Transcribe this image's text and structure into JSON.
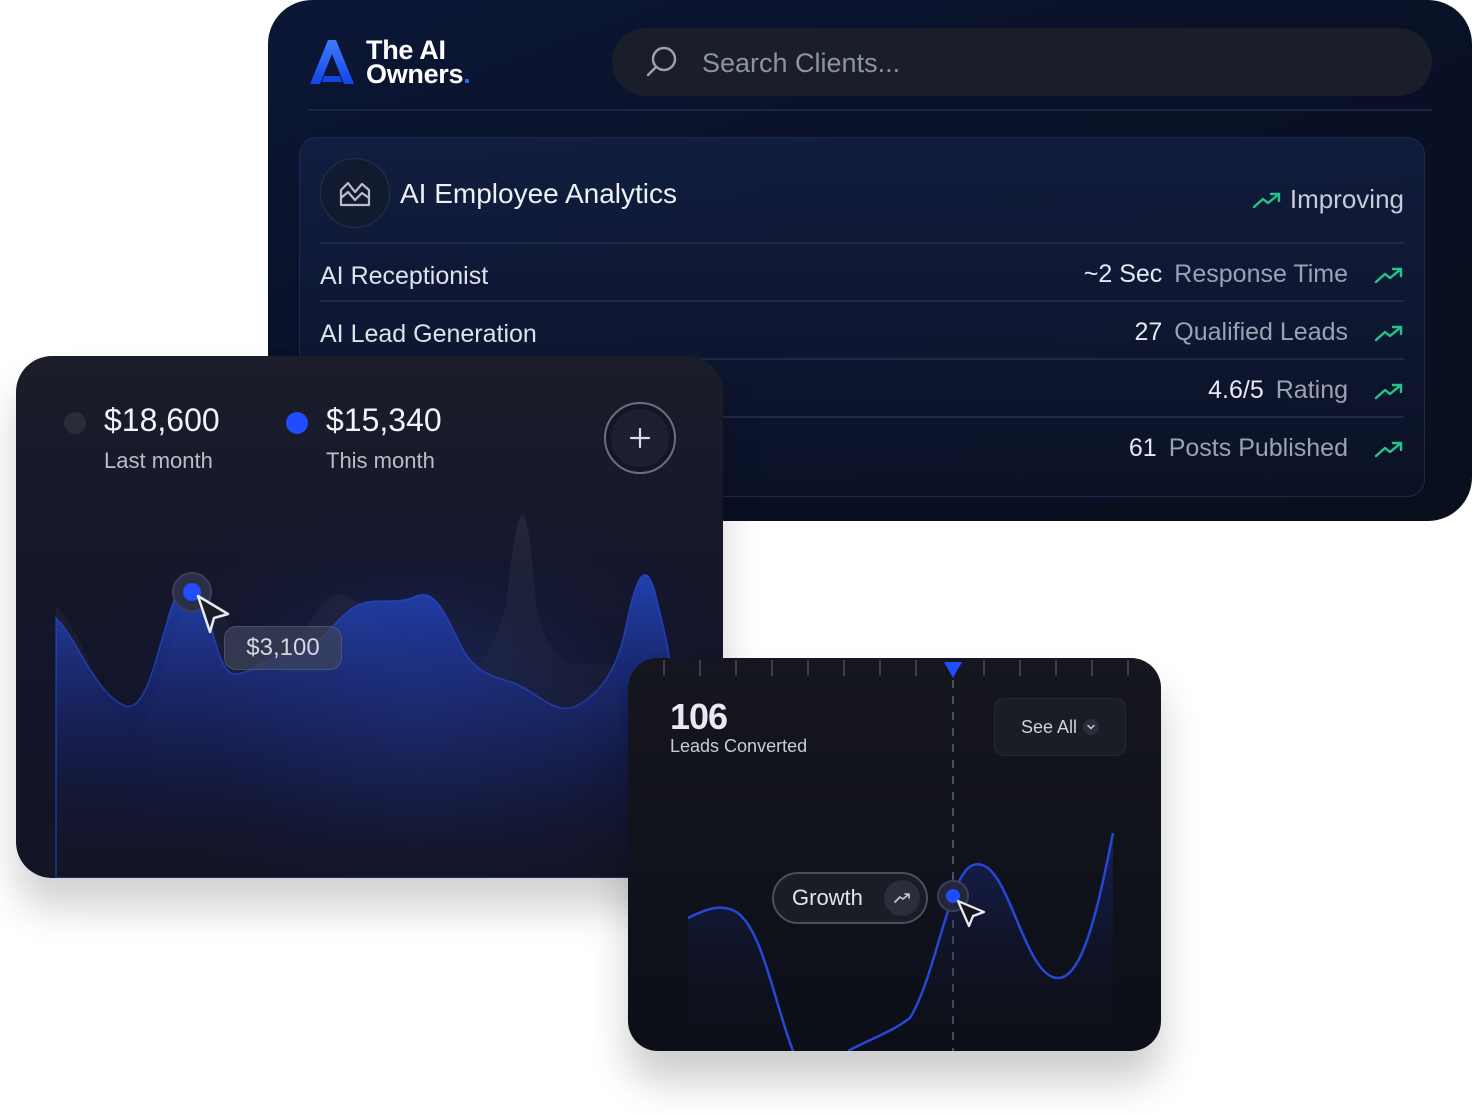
{
  "brand": {
    "name_line1": "The AI",
    "name_line2": "Owners",
    "dot": ".",
    "accent": "#2b6bff"
  },
  "search": {
    "placeholder": "Search Clients..."
  },
  "analytics": {
    "title": "AI Employee Analytics",
    "status": "Improving",
    "trend_color": "#22c58b",
    "rows": [
      {
        "name": "AI Receptionist",
        "value": "~2 Sec",
        "unit": "Response Time"
      },
      {
        "name": "AI Lead Generation",
        "value": "27",
        "unit": "Qualified Leads"
      },
      {
        "name": "",
        "value": "4.6/5",
        "unit": "Rating"
      },
      {
        "name": "",
        "value": "61",
        "unit": "Posts Published"
      }
    ]
  },
  "revenue": {
    "last": {
      "amount": "$18,600",
      "label": "Last month",
      "color": "#2a2c38"
    },
    "current": {
      "amount": "$15,340",
      "label": "This month",
      "color": "#1f4dff"
    },
    "tooltip": "$3,100",
    "add_icon": "plus-icon"
  },
  "leads": {
    "count": "106",
    "label": "Leads Converted",
    "see_all": "See All",
    "badge": "Growth"
  }
}
